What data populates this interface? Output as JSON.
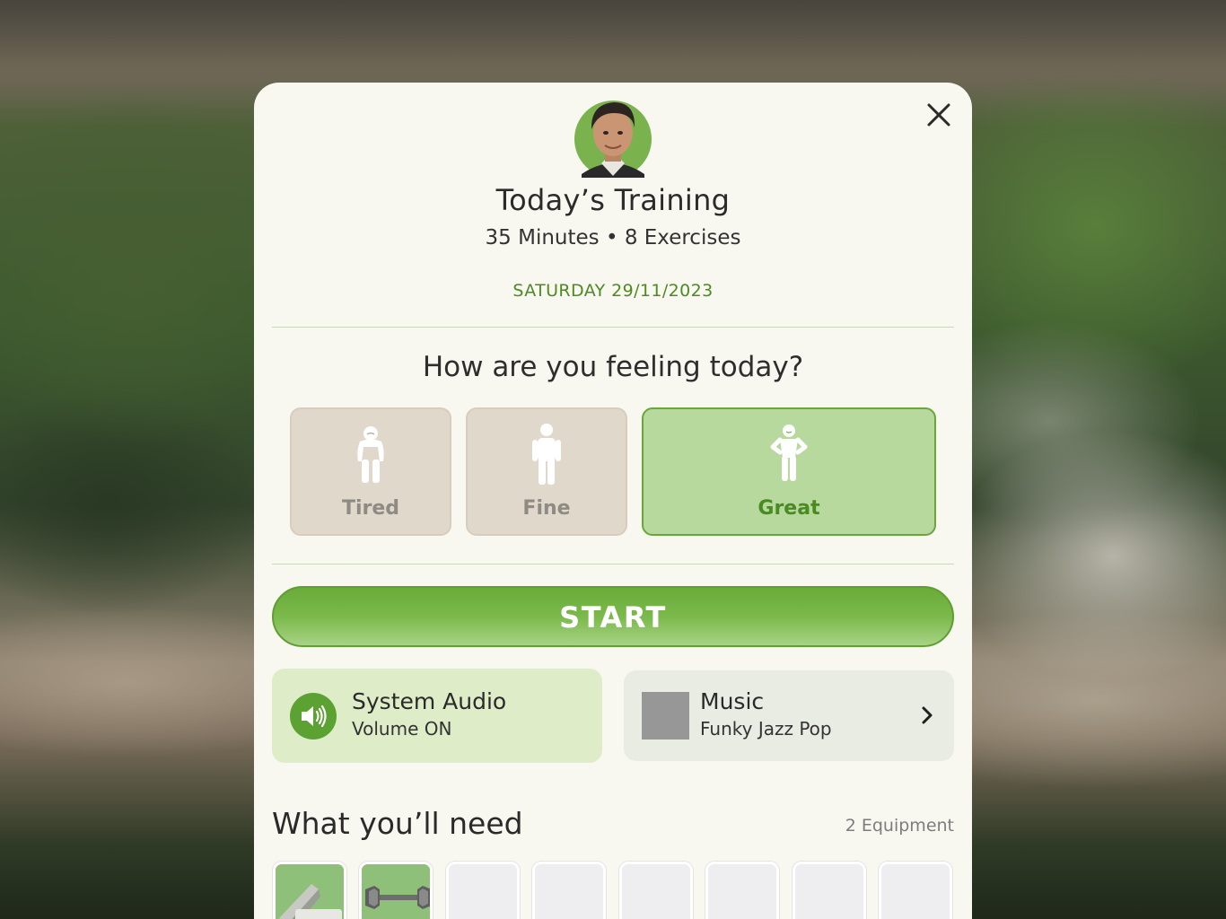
{
  "header": {
    "title": "Today’s Training",
    "subtitle": "35 Minutes • 8 Exercises",
    "date": "SATURDAY 29/11/2023"
  },
  "mood": {
    "question": "How are you feeling today?",
    "options": [
      {
        "label": "Tired",
        "icon": "tired-person-icon",
        "selected": false
      },
      {
        "label": "Fine",
        "icon": "standing-person-icon",
        "selected": false
      },
      {
        "label": "Great",
        "icon": "confident-person-icon",
        "selected": true
      }
    ]
  },
  "start_label": "START",
  "audio": {
    "title": "System Audio",
    "status": "Volume ON",
    "icon": "speaker-icon"
  },
  "music": {
    "title": "Music",
    "genre": "Funky Jazz Pop",
    "icon": "chevron-right-icon"
  },
  "equipment": {
    "heading": "What you’ll need",
    "count": "2 Equipment",
    "items": [
      {
        "icon": "yoga-mat-icon"
      },
      {
        "icon": "dumbbell-icon"
      }
    ]
  },
  "colors": {
    "accent": "#5ba232",
    "accent_dark": "#4a8a22",
    "card_bg": "#f8f7f0",
    "mood_bg": "#e0d8cb",
    "mood_selected_bg": "#b8d99e"
  }
}
